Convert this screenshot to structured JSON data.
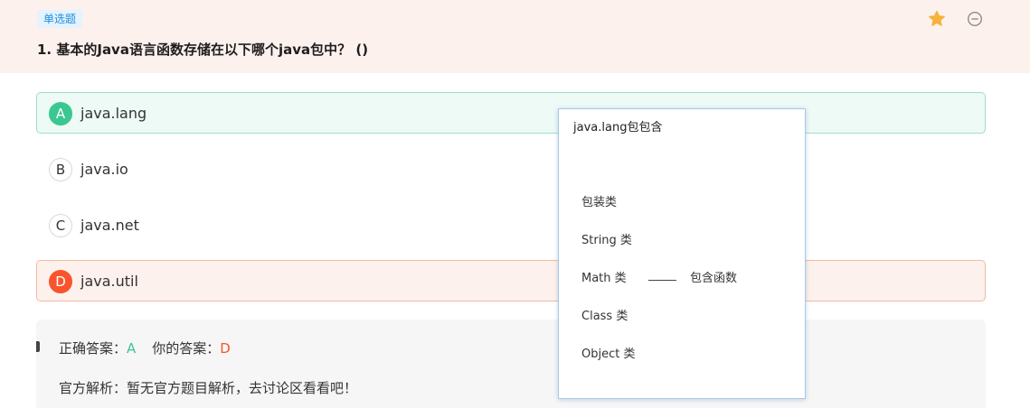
{
  "question": {
    "type_label": "单选题",
    "title": "1. 基本的Java语言函数存储在以下哪个java包中？ ()",
    "icons": {
      "favorite": "star-icon",
      "remove": "minus-circle-icon"
    }
  },
  "options": [
    {
      "letter": "A",
      "text": "java.lang",
      "state": "correct"
    },
    {
      "letter": "B",
      "text": "java.io",
      "state": "normal"
    },
    {
      "letter": "C",
      "text": "java.net",
      "state": "normal"
    },
    {
      "letter": "D",
      "text": "java.util",
      "state": "wrong"
    }
  ],
  "answer": {
    "correct_label": "正确答案：",
    "correct_value": "A",
    "yours_label": "你的答案：",
    "yours_value": "D",
    "analysis": "官方解析：暂无官方题目解析，去讨论区看看吧！"
  },
  "popup": {
    "title": "java.lang包包含",
    "items": [
      "包装类",
      "String 类",
      "Math 类",
      "Class 类",
      "Object 类"
    ],
    "math_note": "包含函数"
  },
  "colors": {
    "correct": "#3ac792",
    "wrong": "#f9542d",
    "header_bg": "#fdf1ed",
    "tag_bg": "#e4f3fd",
    "tag_text": "#1b8fe0",
    "star": "#f6b23a"
  }
}
